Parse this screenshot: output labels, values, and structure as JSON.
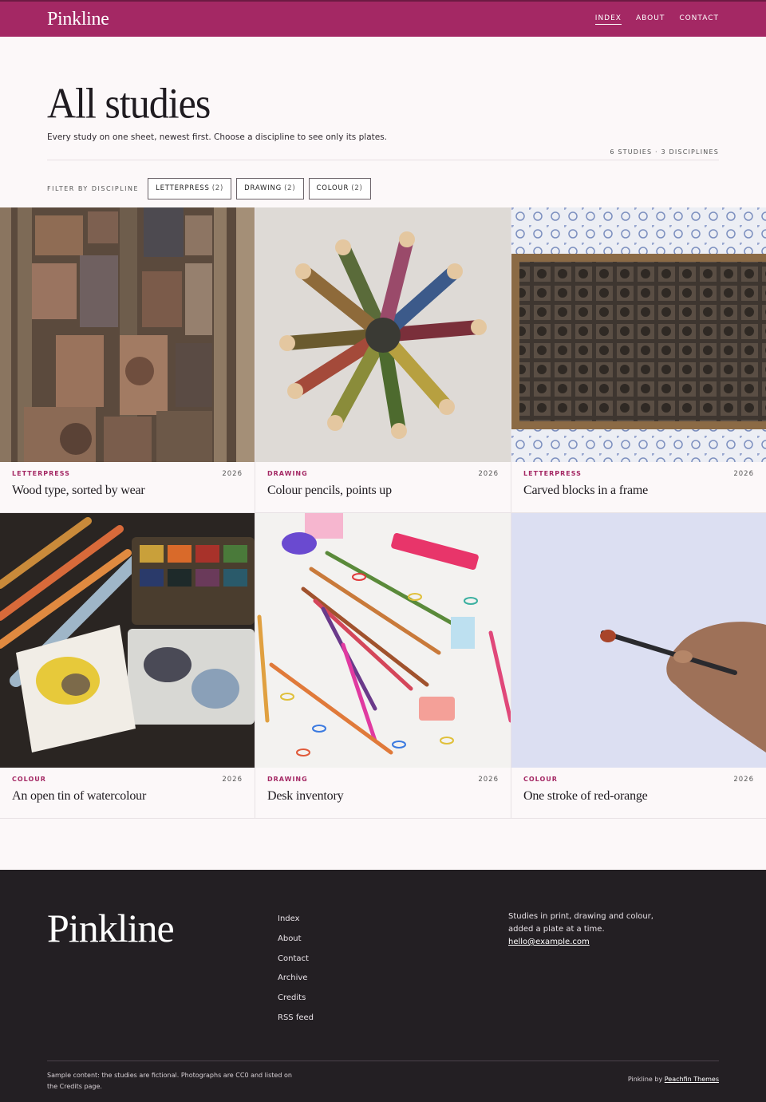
{
  "site": {
    "brand": "Pinkline"
  },
  "nav": [
    {
      "label": "INDEX",
      "active": true
    },
    {
      "label": "ABOUT",
      "active": false
    },
    {
      "label": "CONTACT",
      "active": false
    }
  ],
  "page": {
    "title": "All studies",
    "intro": "Every study on one sheet, newest first. Choose a discipline to see only its plates.",
    "meta": "6 STUDIES · 3 DISCIPLINES"
  },
  "filters": {
    "label": "FILTER BY DISCIPLINE",
    "chips": [
      {
        "label": "LETTERPRESS",
        "count": "(2)"
      },
      {
        "label": "DRAWING",
        "count": "(2)"
      },
      {
        "label": "COLOUR",
        "count": "(2)"
      }
    ]
  },
  "studies": [
    {
      "discipline": "LETTERPRESS",
      "year": "2026",
      "title": "Wood type, sorted by wear",
      "image": "wood-type-photo"
    },
    {
      "discipline": "DRAWING",
      "year": "2026",
      "title": "Colour pencils, points up",
      "image": "colour-pencils-photo"
    },
    {
      "discipline": "LETTERPRESS",
      "year": "2026",
      "title": "Carved blocks in a frame",
      "image": "carved-blocks-photo"
    },
    {
      "discipline": "COLOUR",
      "year": "2026",
      "title": "An open tin of watercolour",
      "image": "watercolour-tin-photo"
    },
    {
      "discipline": "DRAWING",
      "year": "2026",
      "title": "Desk inventory",
      "image": "desk-inventory-photo"
    },
    {
      "discipline": "COLOUR",
      "year": "2026",
      "title": "One stroke of red-orange",
      "image": "brush-stroke-photo"
    }
  ],
  "footer": {
    "brand": "Pinkline",
    "links": [
      "Index",
      "About",
      "Contact",
      "Archive",
      "Credits",
      "RSS feed"
    ],
    "about": "Studies in print, drawing and colour, added a plate at a time.",
    "email": "hello@example.com",
    "note": "Sample content: the studies are fictional. Photographs are CC0 and listed on the Credits page.",
    "credit_prefix": "Pinkline by",
    "credit_link": "Peachfin Themes"
  },
  "colors": {
    "accent": "#a42864",
    "footer_bg": "#231f23",
    "page_bg": "#fcf8f9"
  }
}
